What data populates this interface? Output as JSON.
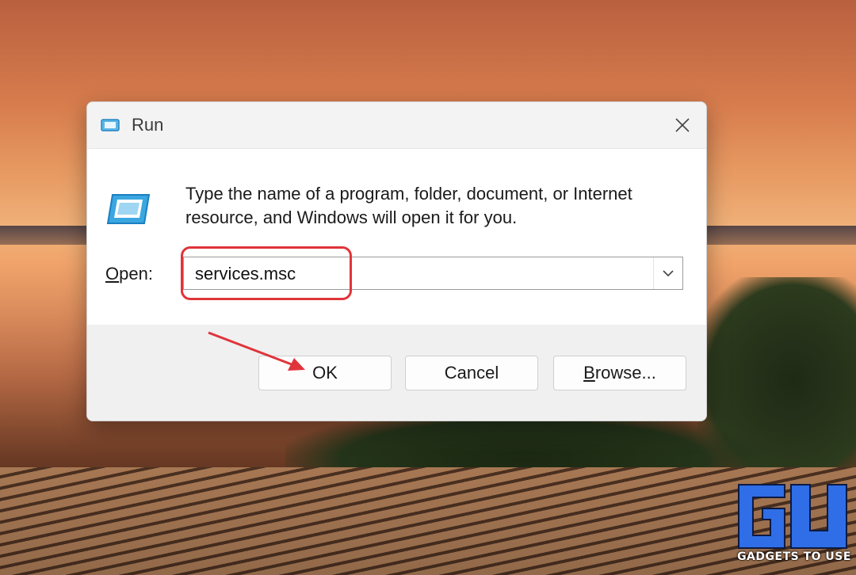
{
  "window": {
    "title": "Run",
    "instruction": "Type the name of a program, folder, document, or Internet resource, and Windows will open it for you."
  },
  "open_field": {
    "label_access_key": "O",
    "label_rest": "pen:",
    "value": "services.msc"
  },
  "buttons": {
    "ok": "OK",
    "cancel": "Cancel",
    "browse_access_key": "B",
    "browse_rest": "rowse..."
  },
  "annotations": {
    "highlight_color": "#e0343a",
    "arrow_color": "#e0343a"
  },
  "icons": {
    "title": "run-icon",
    "main": "run-icon",
    "close": "close-icon",
    "dropdown": "chevron-down-icon"
  },
  "watermark": {
    "text": "GADGETS TO USE",
    "color": "#2f6ee6"
  }
}
